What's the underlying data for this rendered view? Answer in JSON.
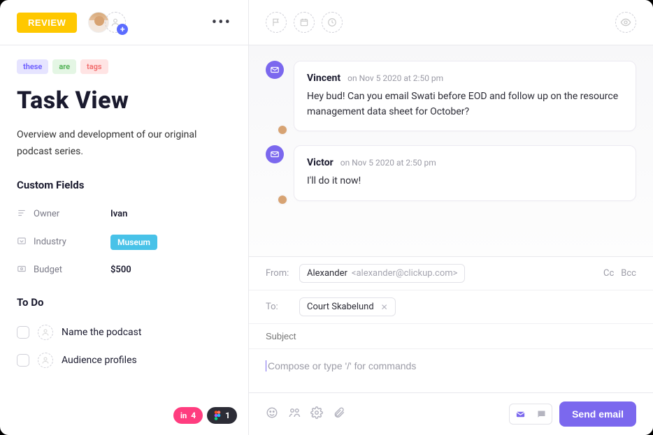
{
  "header": {
    "review_label": "REVIEW"
  },
  "tags": [
    "these",
    "are",
    "tags"
  ],
  "task": {
    "title": "Task View",
    "description": "Overview and development of our original podcast series."
  },
  "custom_fields": {
    "heading": "Custom Fields",
    "rows": [
      {
        "label": "Owner",
        "value": "Ivan"
      },
      {
        "label": "Industry",
        "value": "Museum"
      },
      {
        "label": "Budget",
        "value": "$500"
      }
    ]
  },
  "todo": {
    "heading": "To Do",
    "items": [
      {
        "label": "Name the podcast"
      },
      {
        "label": "Audience profiles"
      }
    ]
  },
  "left_footer": {
    "invision_count": "4",
    "figma_count": "1"
  },
  "thread": [
    {
      "author": "Vincent",
      "time": "on Nov 5 2020 at 2:50 pm",
      "body": "Hey bud! Can you email Swati before EOD and follow up on the resource management data sheet for October?"
    },
    {
      "author": "Victor",
      "time": "on Nov 5 2020 at 2:50 pm",
      "body": "I'll do it now!"
    }
  ],
  "compose": {
    "from_label": "From:",
    "from_name": "Alexander",
    "from_email": "<alexander@clickup.com>",
    "to_label": "To:",
    "to_name": "Court Skabelund",
    "cc_label": "Cc",
    "bcc_label": "Bcc",
    "subject_placeholder": "Subject",
    "body_placeholder": "Compose or type '/' for commands",
    "send_label": "Send email"
  }
}
